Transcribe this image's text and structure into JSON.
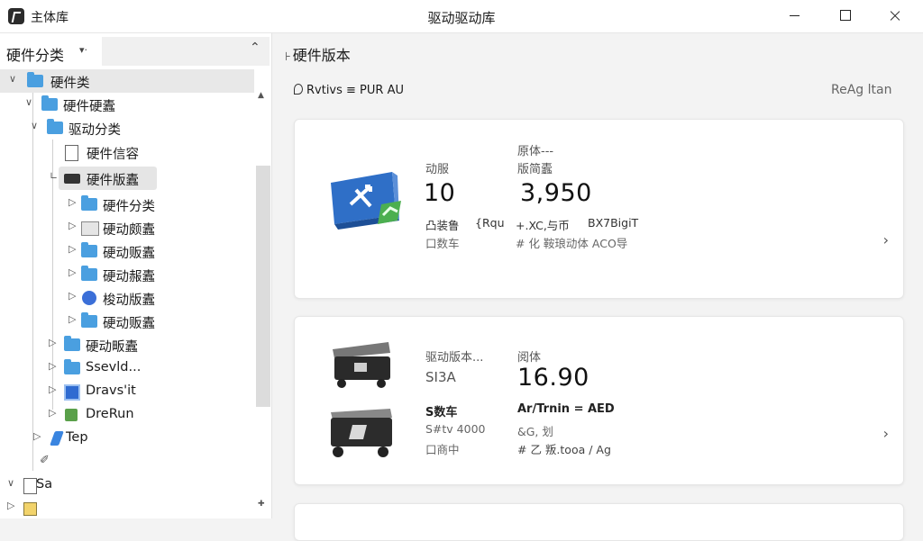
{
  "window": {
    "app_name": "主体库",
    "title": "驱动驱动库"
  },
  "sidebar": {
    "title": "硬件分类",
    "filter_icon": "filter-chevron-icon",
    "tree": [
      {
        "label": "硬件类",
        "icon": "folder"
      },
      {
        "label": "硬件硬蠹",
        "icon": "folder"
      },
      {
        "label": "驱动分类",
        "icon": "folder"
      },
      {
        "label": "硬件信容",
        "icon": "document"
      },
      {
        "label": "硬件版蠹",
        "icon": "chip",
        "selected": true
      },
      {
        "label": "硬件分类",
        "icon": "folder"
      },
      {
        "label": "硬动颇蠹",
        "icon": "folder-outline"
      },
      {
        "label": "硬动贩蠹",
        "icon": "folder"
      },
      {
        "label": "硬动赧蠹",
        "icon": "folder"
      },
      {
        "label": "梭动版蠹",
        "icon": "circle"
      },
      {
        "label": "硬动贩蠹",
        "icon": "folder"
      },
      {
        "label": "硬动畈蠹",
        "icon": "folder"
      },
      {
        "label": "Ssevld...",
        "icon": "folder"
      },
      {
        "label": "Dravs'it",
        "icon": "square"
      },
      {
        "label": "DreRun",
        "icon": "green-package"
      },
      {
        "label": "Tep",
        "icon": "tool"
      },
      {
        "label": "",
        "icon": "pen"
      },
      {
        "label": "Sa",
        "icon": "document"
      },
      {
        "label": "",
        "icon": "image"
      }
    ]
  },
  "main": {
    "section_title": "硬件版本",
    "path_text": "Rvtivs ≡ PUR AU",
    "action_link": "ReAg ltan",
    "cards": [
      {
        "image_icon": "network-adapter-icon",
        "col1_label": "动服",
        "col1_value": "10",
        "col2_label_top": "原体---",
        "col2_label": "版简蠹",
        "col2_value": "3,950",
        "row1": [
          "凸装鲁",
          "{Rqu",
          "+.XC,与币",
          "BX7BigiT"
        ],
        "row2": [
          "口数车",
          "# 化 鞍琅动体  ACO导"
        ]
      },
      {
        "image_icon": "usb-device-icon",
        "col1_label": "驱动版本...",
        "col1_value": "SI3A",
        "col2_label": "阅体",
        "col2_value": "16.90",
        "row1": [
          "S数车",
          "Ar/Trnin = AED"
        ],
        "row2": [
          "S#tv 4000",
          "&G, 划"
        ],
        "row3": [
          "口商中",
          "# 乙 叛.tooa / Ag"
        ]
      },
      {}
    ]
  }
}
